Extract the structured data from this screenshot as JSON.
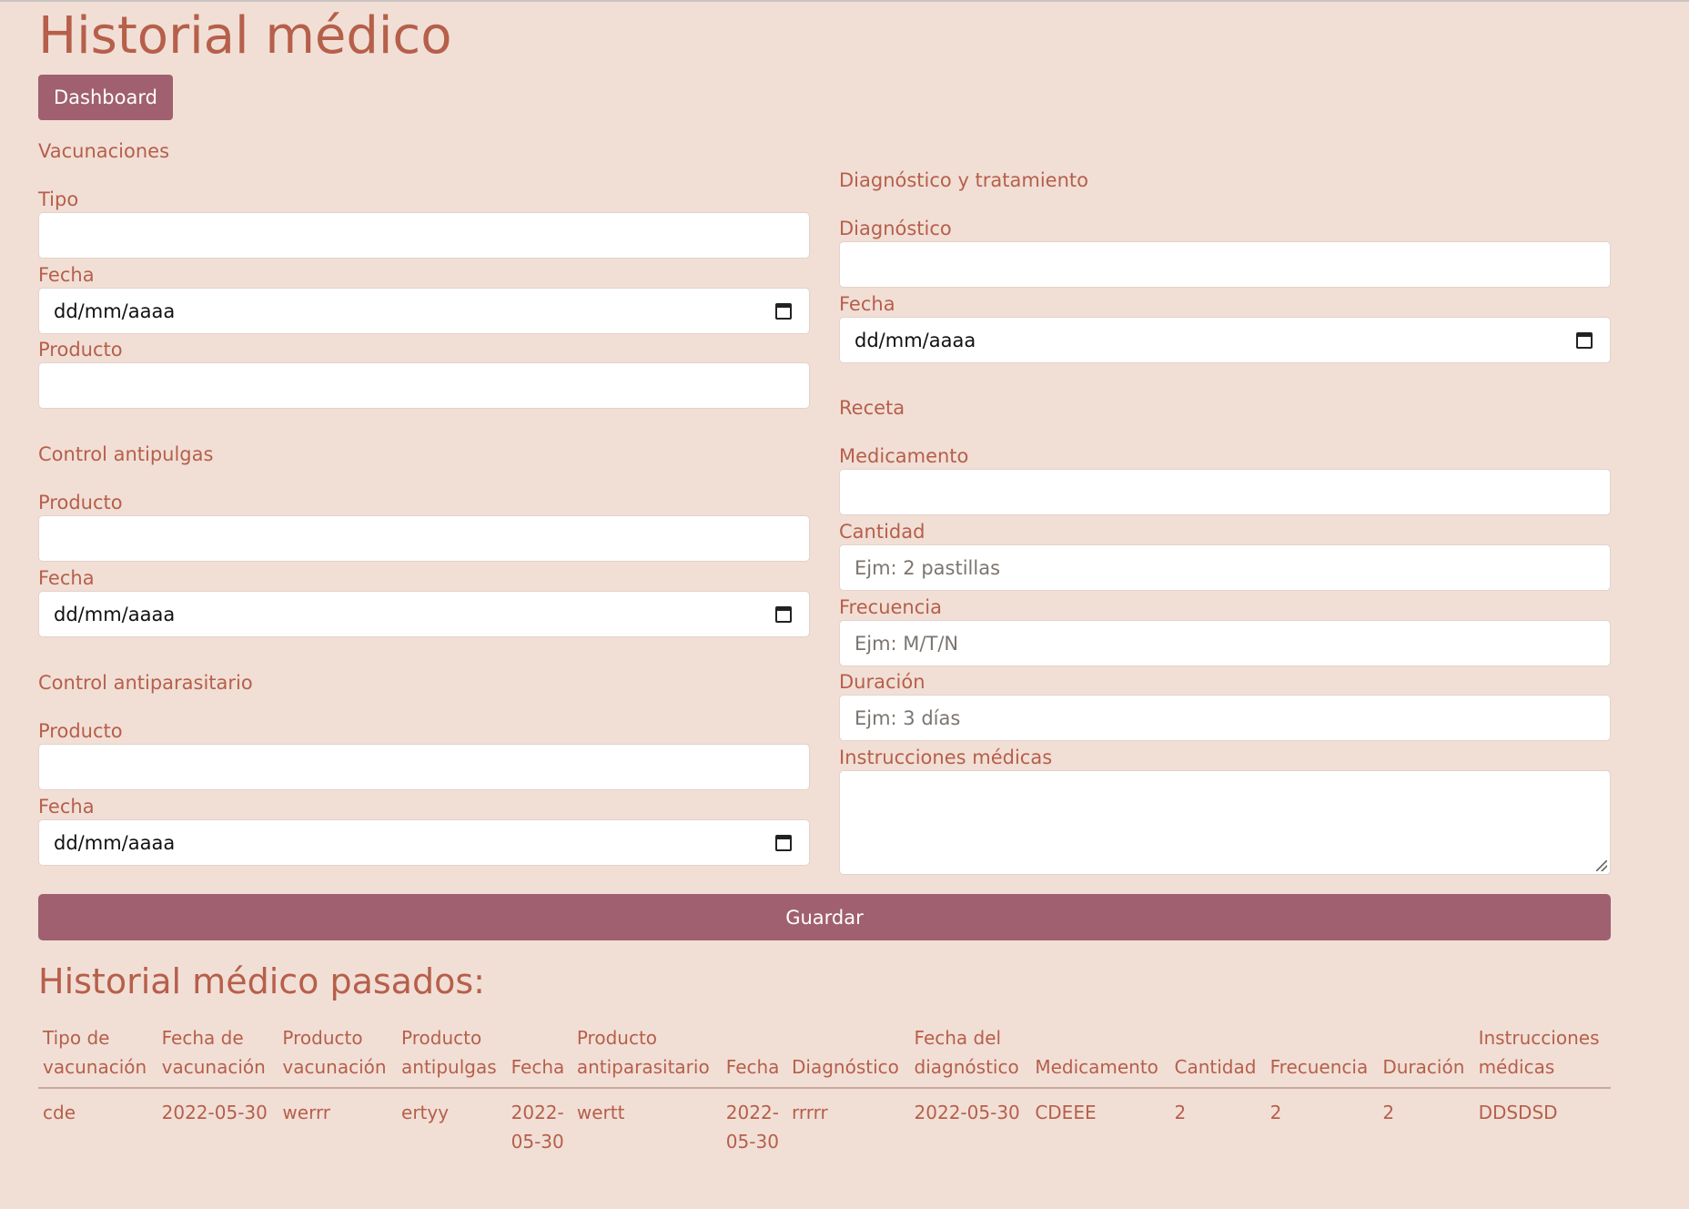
{
  "page": {
    "title": "Historial médico",
    "dashboard_label": "Dashboard",
    "save_label": "Guardar",
    "past_title": "Historial médico pasados:"
  },
  "vacunaciones": {
    "title": "Vacunaciones",
    "tipo_label": "Tipo",
    "fecha_label": "Fecha",
    "fecha_placeholder": "dd/mm/aaaa",
    "producto_label": "Producto"
  },
  "antipulgas": {
    "title": "Control antipulgas",
    "producto_label": "Producto",
    "fecha_label": "Fecha",
    "fecha_placeholder": "dd/mm/aaaa"
  },
  "antiparasitario": {
    "title": "Control antiparasitario",
    "producto_label": "Producto",
    "fecha_label": "Fecha",
    "fecha_placeholder": "dd/mm/aaaa"
  },
  "diagnostico": {
    "title": "Diagnóstico y tratamiento",
    "diagnostico_label": "Diagnóstico",
    "fecha_label": "Fecha",
    "fecha_placeholder": "dd/mm/aaaa"
  },
  "receta": {
    "title": "Receta",
    "medicamento_label": "Medicamento",
    "cantidad_label": "Cantidad",
    "cantidad_placeholder": "Ejm: 2 pastillas",
    "frecuencia_label": "Frecuencia",
    "frecuencia_placeholder": "Ejm: M/T/N",
    "duracion_label": "Duración",
    "duracion_placeholder": "Ejm: 3 días",
    "instrucciones_label": "Instrucciones médicas"
  },
  "table": {
    "headers": [
      [
        "Tipo de",
        "vacunación"
      ],
      [
        "Fecha de",
        "vacunación"
      ],
      [
        "Producto",
        "vacunación"
      ],
      [
        "Producto",
        "antipulgas"
      ],
      [
        "",
        "Fecha"
      ],
      [
        "Producto",
        "antiparasitario"
      ],
      [
        "",
        "Fecha"
      ],
      [
        "",
        "Diagnóstico"
      ],
      [
        "Fecha del",
        "diagnóstico"
      ],
      [
        "",
        "Medicamento"
      ],
      [
        "",
        "Cantidad"
      ],
      [
        "",
        "Frecuencia"
      ],
      [
        "",
        "Duración"
      ],
      [
        "Instrucciones",
        "médicas"
      ]
    ],
    "rows": [
      [
        [
          "cde"
        ],
        [
          "2022-05-30"
        ],
        [
          "werrr"
        ],
        [
          "ertyy"
        ],
        [
          "2022-",
          "05-30"
        ],
        [
          "wertt"
        ],
        [
          "2022-",
          "05-30"
        ],
        [
          "rrrrr"
        ],
        [
          "2022-05-30"
        ],
        [
          "CDEEE"
        ],
        [
          "2"
        ],
        [
          "2"
        ],
        [
          "2"
        ],
        [
          "DDSDSD"
        ]
      ]
    ]
  }
}
